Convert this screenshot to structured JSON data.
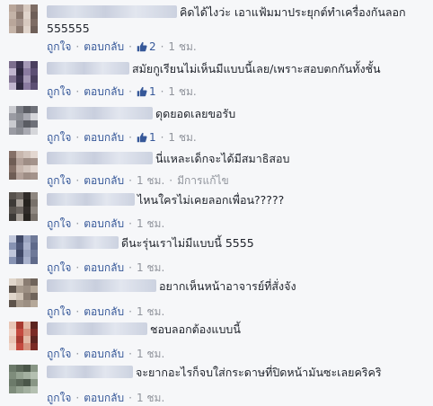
{
  "labels": {
    "like": "ถูกใจ",
    "reply": "ตอบกลับ",
    "sep": "·"
  },
  "colors": {
    "link": "#365899",
    "meta_gray": "#90949c",
    "text": "#1d2129"
  },
  "comments": [
    {
      "text": "คิดได้ไงว่ะ เอาแฟ้มมาประยุกต์ทำเครื่องกันลอก\n555555",
      "likes": "2",
      "time": "1 ชม.",
      "edited": ""
    },
    {
      "text": "สมัยกูเรียนไม่เห็นมีแบบนี้เลย/เพราะสอบตกกันทั้งชั้น",
      "likes": "1",
      "time": "1 ชม.",
      "edited": ""
    },
    {
      "text": "ดุดยอดเลยขอรับ",
      "likes": "1",
      "time": "1 ชม.",
      "edited": ""
    },
    {
      "text": "นี่แหละเด็กจะได้มีสมาธิสอบ",
      "likes": "",
      "time": "1 ชม.",
      "edited": "มีการแก้ไข"
    },
    {
      "text": "ไหนใครไม่เคยลอกเพื่อน?????",
      "likes": "",
      "time": "1 ชม.",
      "edited": ""
    },
    {
      "text": "ดีนะรุ่นเราไม่มีแบบนี้ 5555",
      "likes": "",
      "time": "1 ชม.",
      "edited": ""
    },
    {
      "text": "อยากเห็นหน้าอาจารย์ที่สั่งจัง",
      "likes": "",
      "time": "1 ชม.",
      "edited": ""
    },
    {
      "text": "ชอบลอกต้องแบบนี้",
      "likes": "",
      "time": "1 ชม.",
      "edited": ""
    },
    {
      "text": "จะยากอะไรก็จบใส่กระดาษที่ปิดหน้ามันซะเลยคริคริ",
      "likes": "",
      "time": "1 ชม.",
      "edited": ""
    }
  ]
}
